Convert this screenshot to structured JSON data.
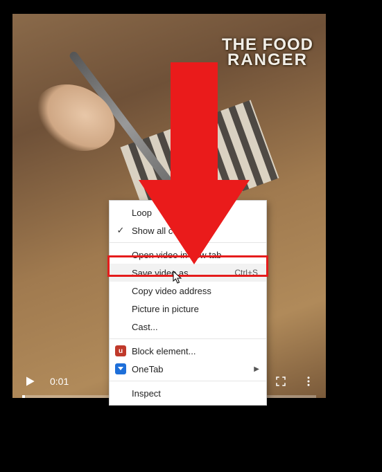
{
  "video": {
    "watermark_line1": "THE FOOD",
    "watermark_line2": "RANGER",
    "current_time": "0:01",
    "progress_pct": 1
  },
  "context_menu": {
    "items": [
      {
        "label": "Loop",
        "checked": false
      },
      {
        "label": "Show all controls",
        "checked": true
      }
    ],
    "items2": [
      {
        "label": "Open video in new tab"
      },
      {
        "label": "Save video as...",
        "shortcut": "Ctrl+S",
        "highlight": true
      },
      {
        "label": "Copy video address"
      },
      {
        "label": "Picture in picture"
      },
      {
        "label": "Cast..."
      }
    ],
    "items3": [
      {
        "label": "Block element...",
        "icon": "ublock",
        "icon_color": "#c0392b",
        "icon_text": "uⒷ"
      },
      {
        "label": "OneTab",
        "icon": "onetab",
        "icon_color": "#1e6fd9",
        "icon_text": "▾",
        "submenu": true
      }
    ],
    "items4": [
      {
        "label": "Inspect"
      }
    ]
  },
  "annotation": {
    "arrow_color": "#ea1b1b"
  }
}
